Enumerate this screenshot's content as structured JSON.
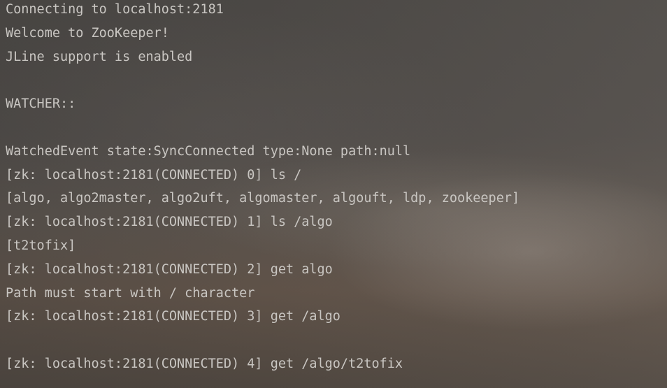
{
  "terminal": {
    "lines": [
      "Connecting to localhost:2181",
      "Welcome to ZooKeeper!",
      "JLine support is enabled",
      "",
      "WATCHER::",
      "",
      "WatchedEvent state:SyncConnected type:None path:null",
      "[zk: localhost:2181(CONNECTED) 0] ls /",
      "[algo, algo2master, algo2uft, algomaster, algouft, ldp, zookeeper]",
      "[zk: localhost:2181(CONNECTED) 1] ls /algo",
      "[t2tofix]",
      "[zk: localhost:2181(CONNECTED) 2] get algo",
      "Path must start with / character",
      "[zk: localhost:2181(CONNECTED) 3] get /algo",
      "",
      "[zk: localhost:2181(CONNECTED) 4] get /algo/t2tofix"
    ]
  }
}
